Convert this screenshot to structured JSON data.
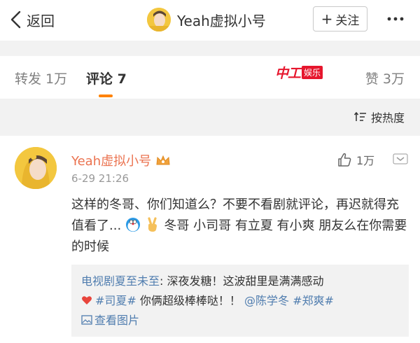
{
  "navbar": {
    "back_label": "返回",
    "title": "Yeah虚拟小号",
    "follow_label": "关注"
  },
  "tabs": {
    "repost": "转发 1万",
    "comment": "评论 7",
    "like": "赞 3万",
    "logo_text": "中工",
    "logo_badge": "娱乐"
  },
  "sort": {
    "label": "按热度"
  },
  "comment": {
    "user": "Yeah虚拟小号",
    "time": "6-29 21:26",
    "likes": "1万",
    "text_part1": "这样的冬哥、你们知道么？不要不看剧就评论，再迟就得充值看了...",
    "text_part2": " 冬哥 小司哥 有立夏 有小爽 朋友么在你需要的时候",
    "quote": {
      "source": "电视剧夏至未至",
      "sep": ": ",
      "text1": "深夜发糖！这波甜里是满满感动",
      "tag1": "#司夏#",
      "text2": " 你俩超级棒棒哒！！",
      "mention": "@陈学冬",
      "tag2": "#郑爽#",
      "pic_label": "查看图片"
    }
  },
  "colors": {
    "accent": "#ff8200",
    "link": "#507daf",
    "username": "#eb7350",
    "bg_gray": "#f2f2f2"
  }
}
